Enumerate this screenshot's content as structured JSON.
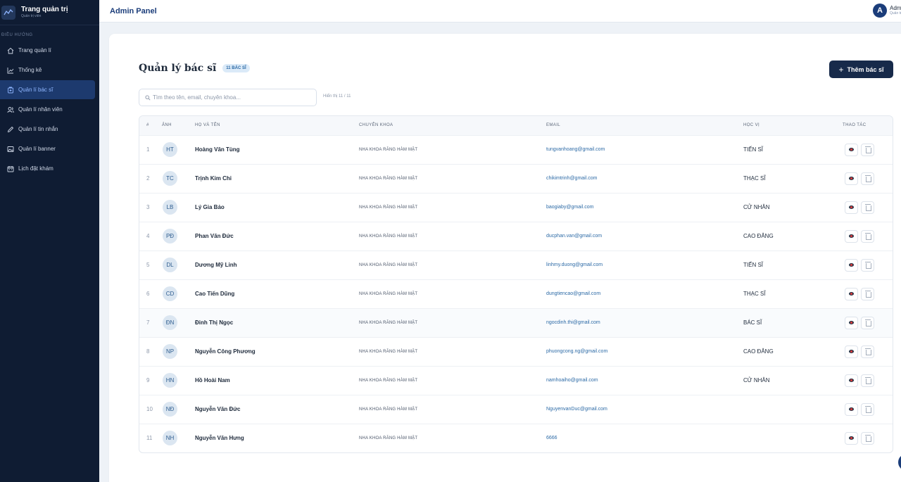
{
  "sidebar": {
    "brand_title": "Trang quản trị",
    "brand_sub": "Quản trị viên",
    "section_label": "ĐIỀU HƯỚNG",
    "items": [
      {
        "label": "Trang quản lí",
        "icon": "home-icon",
        "active": false
      },
      {
        "label": "Thống kê",
        "icon": "chart-icon",
        "active": false
      },
      {
        "label": "Quản lí bác sĩ",
        "icon": "doctor-icon",
        "active": true
      },
      {
        "label": "Quản lí nhân viên",
        "icon": "staff-icon",
        "active": false
      },
      {
        "label": "Quản lí tin nhắn",
        "icon": "message-icon",
        "active": false
      },
      {
        "label": "Quản lí banner",
        "icon": "image-icon",
        "active": false
      },
      {
        "label": "Lịch đặt khám",
        "icon": "calendar-icon",
        "active": false
      }
    ]
  },
  "header": {
    "title": "Admin Panel",
    "user_initial": "A",
    "user_name": "Admin",
    "user_role": "Quản trị viên"
  },
  "main": {
    "title": "Quản lý bác sĩ",
    "count_badge": "11 BÁC SĨ",
    "add_button": "Thêm bác sĩ",
    "search_placeholder": "Tìm theo tên, email, chuyên khoa...",
    "showing": "Hiển thị 11 / 11",
    "columns": [
      "#",
      "ẢNH",
      "HỌ VÀ TÊN",
      "CHUYÊN KHOA",
      "EMAIL",
      "HỌC VỊ",
      "THAO TÁC"
    ],
    "rows": [
      {
        "num": "1",
        "initials": "HT",
        "name": "Hoàng Văn Tùng",
        "specialty": "NHA KHOA RĂNG HÀM MẶT",
        "email": "tungvanhoang@gmail.com",
        "degree": "TIẾN SĨ"
      },
      {
        "num": "2",
        "initials": "TC",
        "name": "Trịnh Kim Chi",
        "specialty": "NHA KHOA RĂNG HÀM MẶT",
        "email": "chikimtrinh@gmail.com",
        "degree": "THẠC SĨ"
      },
      {
        "num": "3",
        "initials": "LB",
        "name": "Lý Gia Bảo",
        "specialty": "NHA KHOA RĂNG HÀM MẶT",
        "email": "baogiaby@gmail.com",
        "degree": "CỬ NHÂN"
      },
      {
        "num": "4",
        "initials": "PĐ",
        "name": "Phan Văn Đức",
        "specialty": "NHA KHOA RĂNG HÀM MẶT",
        "email": "ducphan.van@gmail.com",
        "degree": "CAO ĐẲNG"
      },
      {
        "num": "5",
        "initials": "DL",
        "name": "Dương Mỹ Linh",
        "specialty": "NHA KHOA RĂNG HÀM MẶT",
        "email": "linhmy.duong@gmail.com",
        "degree": "TIẾN SĨ"
      },
      {
        "num": "6",
        "initials": "CD",
        "name": "Cao Tiến Dũng",
        "specialty": "NHA KHOA RĂNG HÀM MẶT",
        "email": "dungtiencao@gmail.com",
        "degree": "THẠC SĨ"
      },
      {
        "num": "7",
        "initials": "ĐN",
        "name": "Đinh Thị Ngọc",
        "specialty": "NHA KHOA RĂNG HÀM MẶT",
        "email": "ngocdinh.thi@gmail.com",
        "degree": "BÁC SĨ"
      },
      {
        "num": "8",
        "initials": "NP",
        "name": "Nguyễn Công Phương",
        "specialty": "NHA KHOA RĂNG HÀM MẶT",
        "email": "phuongcong.ng@gmail.com",
        "degree": "CAO ĐẲNG"
      },
      {
        "num": "9",
        "initials": "HN",
        "name": "Hồ Hoài Nam",
        "specialty": "NHA KHOA RĂNG HÀM MẶT",
        "email": "namhoaiho@gmail.com",
        "degree": "CỬ NHÂN"
      },
      {
        "num": "10",
        "initials": "NĐ",
        "name": "Nguyễn Văn Đức",
        "specialty": "NHA KHOA RĂNG HÀM MẶT",
        "email": "NguyenvanDuc@gmail.com",
        "degree": ""
      },
      {
        "num": "11",
        "initials": "NH",
        "name": "Nguyễn Văn Hưng",
        "specialty": "NHA KHOA RĂNG HÀM MẶT",
        "email": "6666",
        "degree": ""
      }
    ]
  },
  "colors": {
    "sidebar_bg": "#0f1c33",
    "active_item": "#1d3a6e",
    "brand_blue": "#1b3d7a",
    "primary_button": "#172a4a",
    "email_link": "#2c6aa6"
  }
}
